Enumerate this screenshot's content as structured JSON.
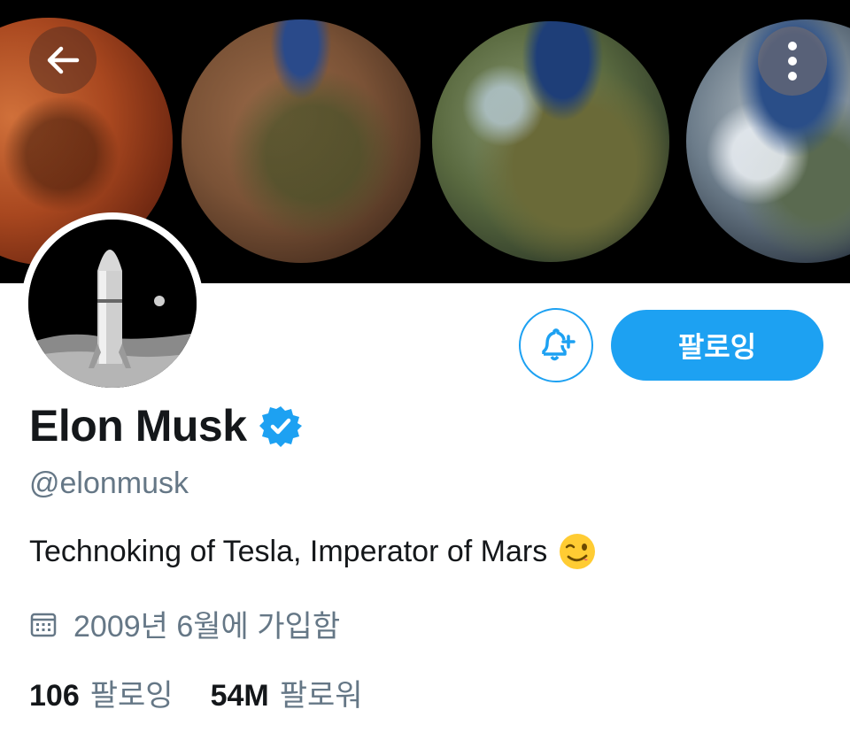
{
  "profile": {
    "display_name": "Elon Musk",
    "verified": true,
    "handle": "@elonmusk",
    "bio": "Technoking of Tesla, Imperator of Mars",
    "bio_emoji": "winking-face",
    "joined": "2009년 6월에 가입함"
  },
  "actions": {
    "follow_label": "팔로잉"
  },
  "stats": {
    "following_count": "106",
    "following_label": "팔로잉",
    "followers_count": "54M",
    "followers_label": "팔로워"
  },
  "icons": {
    "back": "arrow-left-icon",
    "more": "more-vertical-icon",
    "notify": "bell-plus-icon",
    "verified": "verified-badge-icon",
    "calendar": "calendar-icon"
  },
  "colors": {
    "accent": "#1da1f2",
    "text_primary": "#14171a",
    "text_secondary": "#657786",
    "banner_bg": "#000000"
  }
}
